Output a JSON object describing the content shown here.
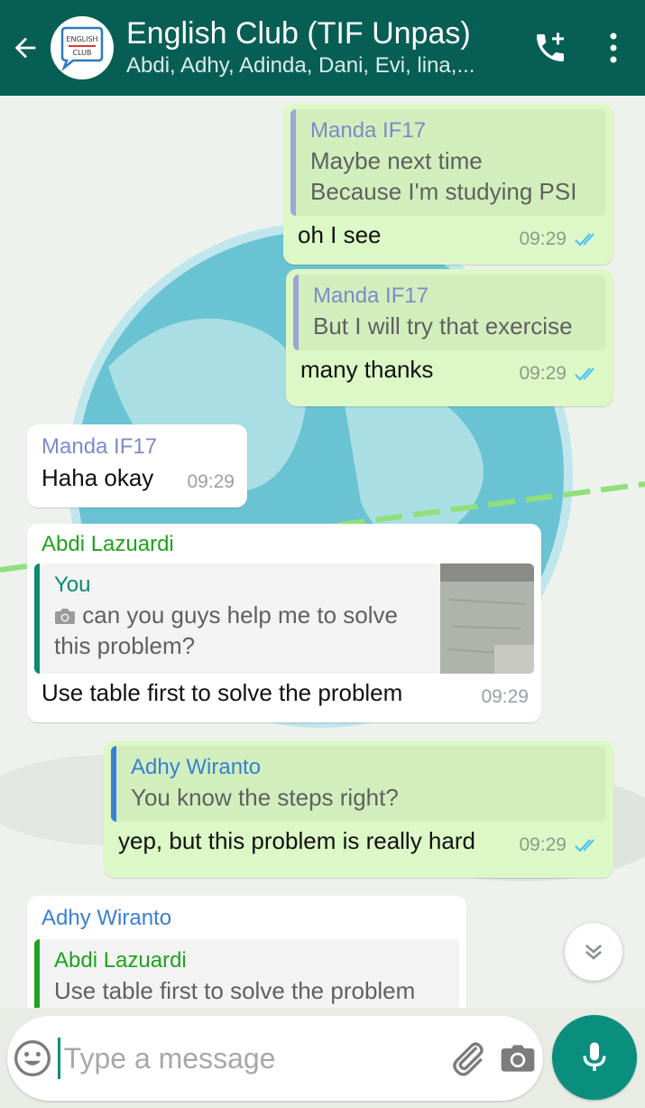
{
  "header": {
    "title": "English Club (TIF Unpas)",
    "members": "Abdi, Adhy, Adinda, Dani, Evi, lina,...",
    "avatar_text_top": "ENGLISH",
    "avatar_text_bottom": "CLUB"
  },
  "messages": [
    {
      "direction": "out",
      "quote_author": "Manda IF17",
      "quote_lines": [
        "Maybe next time",
        "Because I'm studying PSI"
      ],
      "text": "oh I see",
      "time": "09:29",
      "status": "read"
    },
    {
      "direction": "out",
      "quote_author": "Manda IF17",
      "quote_lines": [
        "But I will try that exercise"
      ],
      "text": "many thanks",
      "time": "09:29",
      "status": "read"
    },
    {
      "direction": "in",
      "sender": "Manda IF17",
      "text": "Haha okay",
      "time": "09:29"
    },
    {
      "direction": "in",
      "sender": "Abdi Lazuardi",
      "quote_author": "You",
      "quote_lines": [
        "can you guys help me to solve",
        "this problem?"
      ],
      "quote_has_photo": true,
      "text": "Use table first to solve the problem",
      "time": "09:29"
    },
    {
      "direction": "out",
      "quote_author": "Adhy Wiranto",
      "quote_lines": [
        "You know the steps right?"
      ],
      "text": "yep, but this problem is really hard",
      "time": "09:29",
      "status": "read"
    },
    {
      "direction": "in",
      "sender": "Adhy Wiranto",
      "quote_author": "Abdi Lazuardi",
      "quote_lines": [
        "Use table first to solve the problem"
      ]
    }
  ],
  "composer": {
    "placeholder": "Type a message"
  },
  "colors": {
    "header": "#075e54",
    "outgoing_bubble": "#dcf8c6",
    "incoming_bubble": "#ffffff",
    "read_ticks": "#4fc3f7",
    "name_manda": "#7c8bc9",
    "name_abdi": "#1fa21f",
    "name_adhy": "#3a7fd6",
    "name_you": "#0c8a72",
    "mic_button": "#0a8f7f"
  }
}
